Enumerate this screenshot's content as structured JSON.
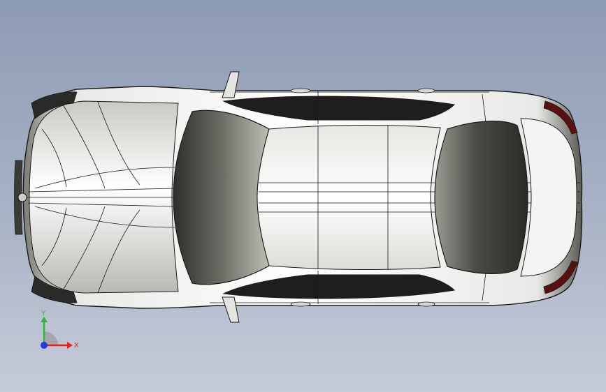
{
  "viewport": {
    "background_top": "#8d9bb3",
    "background_bottom": "#c6cbd8"
  },
  "model": {
    "name_icon": "car-top-view-model",
    "body_color": "#f2f2f2",
    "glass_color": "#3b3b38",
    "edge_color": "#1a1a1a"
  },
  "triad": {
    "x_label": "X",
    "y_label": "Y",
    "x_color": "#e0241b",
    "y_color": "#2dbb2d",
    "z_color": "#1f3bd9"
  }
}
